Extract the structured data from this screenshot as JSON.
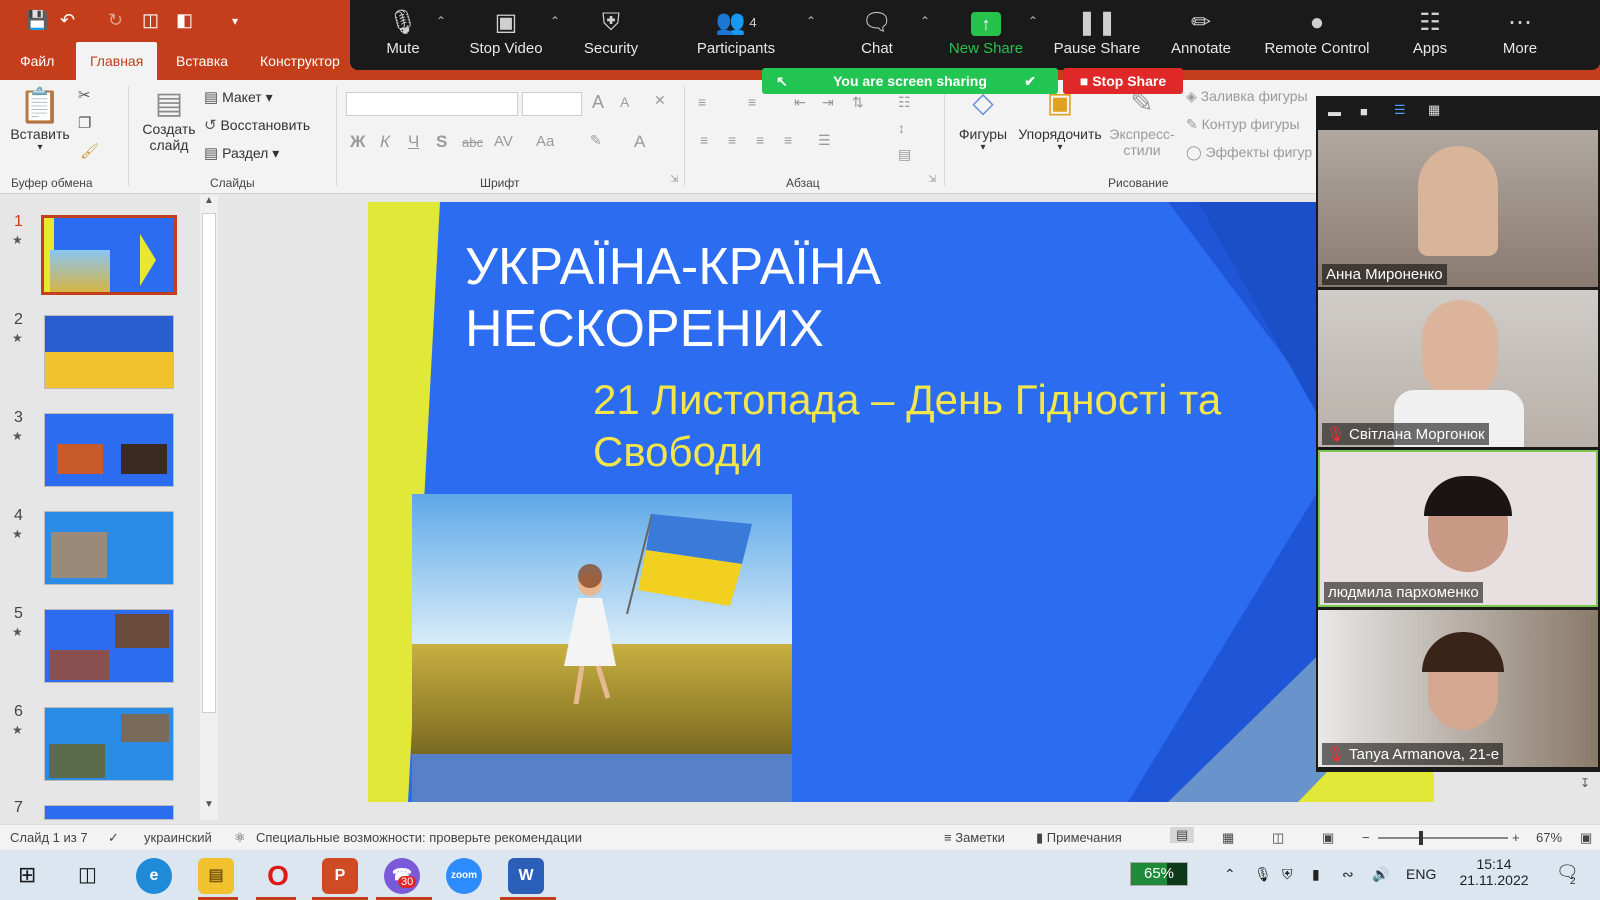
{
  "ppt": {
    "tabs": [
      {
        "label": "Файл"
      },
      {
        "label": "Главная"
      },
      {
        "label": "Вставка"
      },
      {
        "label": "Конструктор"
      }
    ],
    "ribbon": {
      "clipboard": {
        "paste": "Вставить",
        "group": "Буфер обмена"
      },
      "slides": {
        "new_slide_line1": "Создать",
        "new_slide_line2": "слайд",
        "layout": "Макет",
        "reset": "Восстановить",
        "section": "Раздел",
        "group": "Слайды"
      },
      "font": {
        "bold": "Ж",
        "italic": "К",
        "underline": "Ч",
        "shadow": "S",
        "strike": "abc",
        "spacing": "AV",
        "case": "Aa",
        "color": "A",
        "grow": "A",
        "shrink": "A",
        "group": "Шрифт"
      },
      "paragraph": {
        "group": "Абзац"
      },
      "drawing": {
        "shapes": "Фигуры",
        "arrange": "Упорядочить",
        "styles_line1": "Экспресс-",
        "styles_line2": "стили",
        "fill": "Заливка фигуры",
        "outline": "Контур фигуры",
        "effects": "Эффекты фигур",
        "group": "Рисование"
      }
    },
    "thumbnails": [
      {
        "num": "1"
      },
      {
        "num": "2"
      },
      {
        "num": "3"
      },
      {
        "num": "4"
      },
      {
        "num": "5"
      },
      {
        "num": "6"
      },
      {
        "num": "7"
      }
    ],
    "slide": {
      "title_line1": "УКРАЇНА-КРАЇНА",
      "title_line2": "НЕСКОРЕНИХ",
      "subtitle_line1": "21  Листопада – День Гідності та",
      "subtitle_line2": "Свободи"
    },
    "status": {
      "slide_of": "Слайд 1 из 7",
      "language": "украинский",
      "accessibility": "Специальные возможности: проверьте рекомендации",
      "notes": "Заметки",
      "comments": "Примечания",
      "zoom": "67%"
    }
  },
  "zoom": {
    "toolbar": [
      {
        "label": "Mute",
        "icon": "microphone-icon"
      },
      {
        "label": "Stop Video",
        "icon": "video-camera-icon"
      },
      {
        "label": "Security",
        "icon": "shield-icon"
      },
      {
        "label": "Participants",
        "icon": "participants-icon",
        "count": "4"
      },
      {
        "label": "Chat",
        "icon": "chat-icon"
      },
      {
        "label": "New Share",
        "icon": "share-arrow-icon"
      },
      {
        "label": "Pause Share",
        "icon": "pause-icon"
      },
      {
        "label": "Annotate",
        "icon": "pencil-icon"
      },
      {
        "label": "Remote Control",
        "icon": "mouse-icon"
      },
      {
        "label": "Apps",
        "icon": "apps-icon"
      },
      {
        "label": "More",
        "icon": "more-icon"
      }
    ],
    "banner": "You are screen sharing",
    "stop_share": "Stop Share",
    "participants": [
      {
        "name": "Анна Мироненко",
        "muted": false
      },
      {
        "name": "Світлана Моргонюк",
        "muted": true
      },
      {
        "name": "людмила пархоменко",
        "muted": false
      },
      {
        "name": "Tanya Armanova, 21-e",
        "muted": true
      }
    ],
    "colors": {
      "toolbar": "#1a1a1a",
      "share_green": "#23c552",
      "stop_red": "#e02828"
    }
  },
  "taskbar": {
    "battery": "65%",
    "lang": "ENG",
    "time": "15:14",
    "date": "21.11.2022",
    "viber_badge": "30",
    "notification_count": "2"
  }
}
